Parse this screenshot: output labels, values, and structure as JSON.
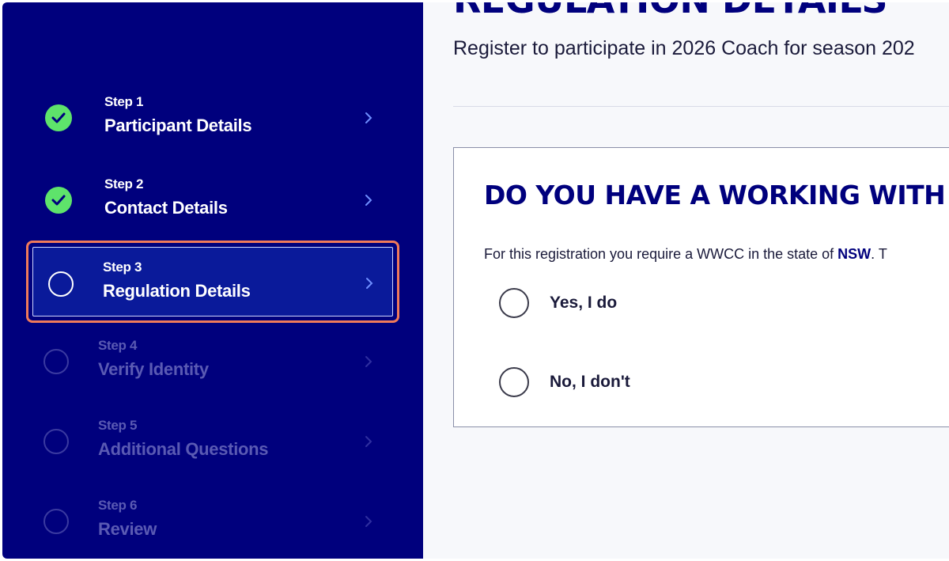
{
  "sidebar": {
    "steps": [
      {
        "number": "Step 1",
        "title": "Participant Details",
        "status": "complete"
      },
      {
        "number": "Step 2",
        "title": "Contact Details",
        "status": "complete"
      },
      {
        "number": "Step 3",
        "title": "Regulation Details",
        "status": "current"
      },
      {
        "number": "Step 4",
        "title": "Verify Identity",
        "status": "upcoming"
      },
      {
        "number": "Step 5",
        "title": "Additional Questions",
        "status": "upcoming"
      },
      {
        "number": "Step 6",
        "title": "Review",
        "status": "upcoming"
      }
    ]
  },
  "main": {
    "title": "REGULATION DETAILS",
    "subtitle": "Register to participate in 2026 Coach for season 202",
    "card": {
      "question": "DO YOU HAVE A WORKING WITH",
      "requirement_prefix": "For this registration you require a WWCC in the state of ",
      "requirement_state": "NSW",
      "requirement_suffix": ". T",
      "options": [
        {
          "label": "Yes, I do"
        },
        {
          "label": "No, I don't"
        }
      ]
    }
  },
  "colors": {
    "sidebar_bg": "#00007d",
    "complete_green": "#5ee36b",
    "highlight_border": "#f07a5a",
    "brand_navy": "#00007d"
  }
}
